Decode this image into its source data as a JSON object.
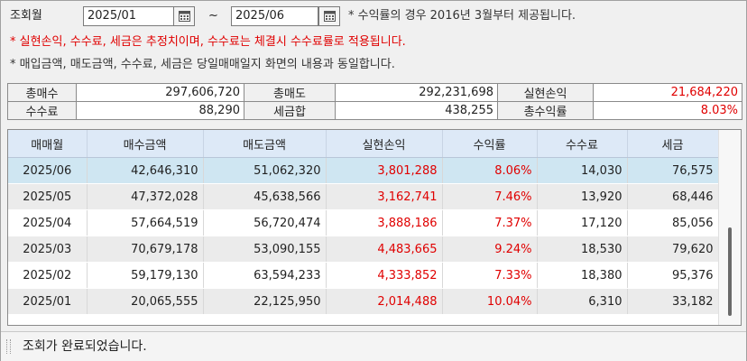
{
  "query": {
    "label": "조회월",
    "start_date": "2025/01",
    "separator": "~",
    "end_date": "2025/06"
  },
  "notes": {
    "line1": "* 수익률의 경우 2016년 3월부터 제공됩니다.",
    "line2": "* 실현손익, 수수료, 세금은 추정치이며, 수수료는 체결시 수수료률로 적용됩니다.",
    "line3": "* 매입금액, 매도금액, 수수료, 세금은 당일매매일지 화면의 내용과 동일합니다."
  },
  "summary": {
    "total_buy_label": "총매수",
    "total_buy": "297,606,720",
    "total_sell_label": "총매도",
    "total_sell": "292,231,698",
    "realized_label": "실현손익",
    "realized": "21,684,220",
    "fee_label": "수수료",
    "fee": "88,290",
    "tax_label": "세금합",
    "tax": "438,255",
    "return_label": "총수익률",
    "return": "8.03%"
  },
  "table": {
    "headers": [
      "매매월",
      "매수금액",
      "매도금액",
      "실현손익",
      "수익률",
      "수수료",
      "세금"
    ],
    "rows": [
      [
        "2025/06",
        "42,646,310",
        "51,062,320",
        "3,801,288",
        "8.06%",
        "14,030",
        "76,575"
      ],
      [
        "2025/05",
        "47,372,028",
        "45,638,566",
        "3,162,741",
        "7.46%",
        "13,920",
        "68,446"
      ],
      [
        "2025/04",
        "57,664,519",
        "56,720,474",
        "3,888,186",
        "7.37%",
        "17,120",
        "85,056"
      ],
      [
        "2025/03",
        "70,679,178",
        "53,090,155",
        "4,483,665",
        "9.24%",
        "18,530",
        "79,620"
      ],
      [
        "2025/02",
        "59,179,130",
        "63,594,233",
        "4,333,852",
        "7.33%",
        "18,380",
        "95,376"
      ],
      [
        "2025/01",
        "20,065,555",
        "22,125,950",
        "2,014,488",
        "10.04%",
        "6,310",
        "33,182"
      ]
    ],
    "selected_row": 0
  },
  "status": {
    "message": "조회가 완료되었습니다."
  },
  "colors": {
    "profit_red": "#e00000",
    "header_blue": "#dde9f7",
    "selected_row": "#cfe6f2"
  }
}
